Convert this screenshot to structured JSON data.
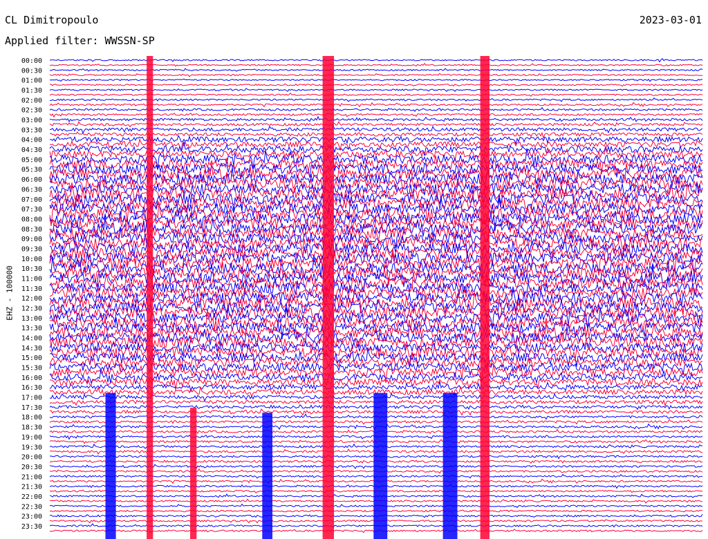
{
  "header": {
    "station": "CL Dimitropoulo",
    "date": "2023-03-01",
    "filter": "Applied filter: WWSSN-SP"
  },
  "chart_data": {
    "type": "line",
    "title": "CL Dimitropoulo",
    "ylabel": "EHZ - 100000",
    "colors": [
      "#0000ff",
      "#ff0033"
    ],
    "y_tick_labels": [
      "00:00",
      "00:30",
      "01:00",
      "01:30",
      "02:00",
      "02:30",
      "03:00",
      "03:30",
      "04:00",
      "04:30",
      "05:00",
      "05:30",
      "06:00",
      "06:30",
      "07:00",
      "07:30",
      "08:00",
      "08:30",
      "09:00",
      "09:30",
      "10:00",
      "10:30",
      "11:00",
      "11:30",
      "12:00",
      "12:30",
      "13:00",
      "13:30",
      "14:00",
      "14:30",
      "15:00",
      "15:30",
      "16:00",
      "16:30",
      "17:00",
      "17:30",
      "18:00",
      "18:30",
      "19:00",
      "19:30",
      "20:00",
      "20:30",
      "21:00",
      "21:30",
      "22:00",
      "22:30",
      "23:00",
      "23:30"
    ],
    "x_range_minutes": [
      0,
      15
    ],
    "trace_minutes_per_line": 15,
    "lines_per_hour": 4,
    "noise_envelope_by_half_hour": [
      1,
      1,
      1,
      1,
      1.2,
      1.4,
      1.8,
      2.4,
      3.5,
      4.5,
      6,
      7,
      7.5,
      7.5,
      7.5,
      7.5,
      7.5,
      7.5,
      7.5,
      7.5,
      7.5,
      7.5,
      7.5,
      7.5,
      7.5,
      7.5,
      7,
      7,
      7,
      6.5,
      6,
      5.5,
      4.5,
      3.5,
      2.5,
      2,
      1.6,
      1.5,
      1.5,
      1.5,
      1.4,
      1.3,
      1.2,
      1.2,
      1.2,
      1.2,
      1.2,
      1.2
    ],
    "bursts": [
      {
        "minute": 10.0,
        "from_hhmm": "00:00",
        "to_hhmm": "23:45",
        "color": "#ff0033"
      },
      {
        "minute": 2.3,
        "from_hhmm": "00:00",
        "to_hhmm": "23:45",
        "color": "#ff0033"
      },
      {
        "minute": 6.4,
        "from_hhmm": "00:00",
        "to_hhmm": "23:45",
        "color": "#ff0033"
      },
      {
        "minute": 3.3,
        "from_hhmm": "17:45",
        "to_hhmm": "23:45",
        "color": "#ff0033"
      },
      {
        "minute": 1.4,
        "from_hhmm": "17:00",
        "to_hhmm": "23:45",
        "color": "#0000ff"
      },
      {
        "minute": 5.0,
        "from_hhmm": "18:00",
        "to_hhmm": "23:45",
        "color": "#0000ff"
      },
      {
        "minute": 7.6,
        "from_hhmm": "17:00",
        "to_hhmm": "23:45",
        "color": "#0000ff"
      },
      {
        "minute": 9.2,
        "from_hhmm": "17:00",
        "to_hhmm": "23:45",
        "color": "#0000ff"
      }
    ]
  }
}
